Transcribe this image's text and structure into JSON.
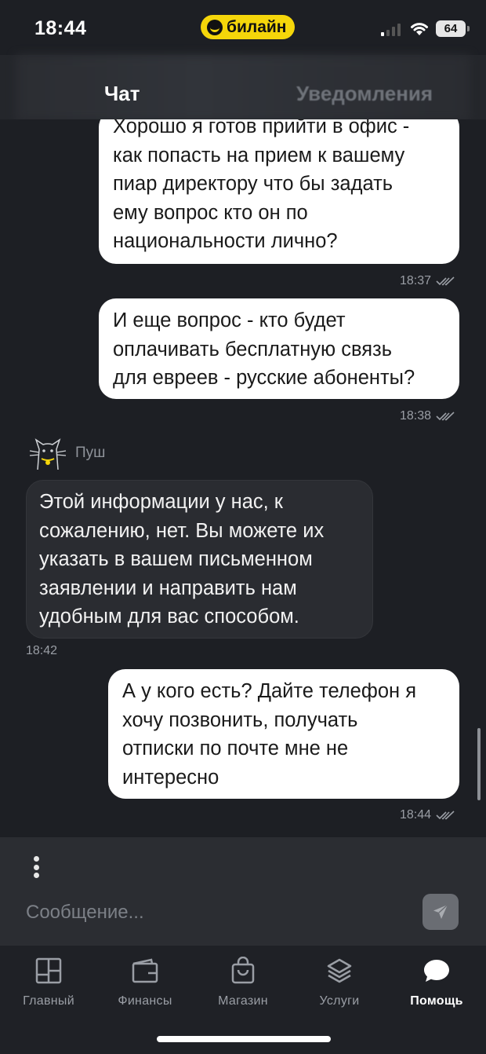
{
  "status_bar": {
    "time": "18:44",
    "carrier": "билайн",
    "battery": "64"
  },
  "tabs": [
    {
      "label": "Чат",
      "active": true
    },
    {
      "label": "Уведомления",
      "active": false
    }
  ],
  "messages": [
    {
      "direction": "out",
      "lines": [
        "Хорошо я готов прийти в офис -",
        "как попасть на прием к вашему",
        "пиар директору что бы задать",
        "ему вопрос кто он по",
        "национальности лично?"
      ],
      "time": "18:37"
    },
    {
      "direction": "out",
      "lines": [
        "И еще вопрос - кто будет",
        "оплачивать бесплатную связь",
        "для евреев - русские абоненты?"
      ],
      "time": "18:38"
    },
    {
      "direction": "in",
      "sender": "Пуш",
      "lines": [
        "Этой информации у нас, к",
        "сожалению, нет. Вы можете их",
        "указать в вашем письменном",
        "заявлении и направить нам",
        "удобным для вас способом."
      ],
      "time": "18:42"
    },
    {
      "direction": "out",
      "lines": [
        "А у кого есть? Дайте телефон я",
        "хочу позвонить, получать",
        "отписки по почте мне не",
        "интересно"
      ],
      "time": "18:44"
    }
  ],
  "composer": {
    "placeholder": "Сообщение..."
  },
  "bottom_nav": [
    {
      "label": "Главный",
      "icon": "home-grid-icon",
      "active": false
    },
    {
      "label": "Финансы",
      "icon": "wallet-icon",
      "active": false
    },
    {
      "label": "Магазин",
      "icon": "shopping-bag-icon",
      "active": false
    },
    {
      "label": "Услуги",
      "icon": "layers-icon",
      "active": false
    },
    {
      "label": "Помощь",
      "icon": "chat-bubble-icon",
      "active": true
    }
  ],
  "colors": {
    "background": "#1d1f24",
    "outgoing_bubble": "#ffffff",
    "incoming_bubble": "#2a2c31",
    "carrier_badge": "#f5d60a"
  }
}
